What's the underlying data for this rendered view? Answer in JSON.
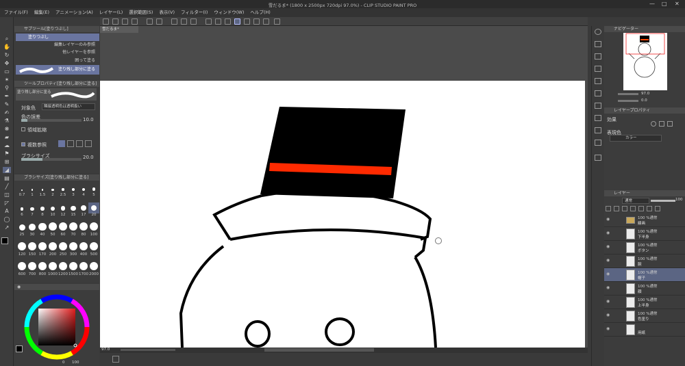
{
  "window": {
    "title": "雪だるま* (1800 x 2500px 720dpi 97.0%) - CLIP STUDIO PAINT PRO"
  },
  "menu": [
    "ファイル(F)",
    "編集(E)",
    "アニメーション(A)",
    "レイヤー(L)",
    "選択範囲(S)",
    "表示(V)",
    "フィルター(I)",
    "ウィンドウ(W)",
    "ヘルプ(H)"
  ],
  "document_tab": "雪だるま*",
  "subtool": {
    "header": "サブツール[塗りつぶし]",
    "items": [
      "塗りつぶし",
      "編集レイヤーのみ参照",
      "他レイヤーを参照",
      "囲って塗る",
      "塗り残し部分に塗る"
    ],
    "selected": "塗り残し部分に塗る"
  },
  "tool_property": {
    "header": "ツールプロパティ[塗り残し部分に塗る]",
    "brush_name": "塗り残し部分に塗る",
    "target_color_label": "対象色",
    "target_color_value": "隣接透明色は透明扱い",
    "color_margin_label": "色の誤差",
    "color_margin_value": "10.0",
    "area_scaling_label": "領域拡縮",
    "multi_ref_label": "複数参照",
    "brush_size_label": "ブラシサイズ",
    "brush_size_value": "20.0"
  },
  "brush_size_panel": {
    "header": "ブラシサイズ[塗り残し部分に塗る]",
    "sizes": [
      "0.7",
      "1",
      "1.5",
      "2",
      "2.5",
      "3",
      "4",
      "5",
      "6",
      "7",
      "8",
      "10",
      "12",
      "15",
      "17",
      "20",
      "25",
      "30",
      "40",
      "50",
      "60",
      "70",
      "80",
      "100",
      "120",
      "150",
      "170",
      "200",
      "250",
      "300",
      "400",
      "500",
      "600",
      "700",
      "800",
      "1000",
      "1200",
      "1500",
      "1700",
      "2000"
    ],
    "selected": "20"
  },
  "color_panel": {
    "value_label": "0",
    "size_label": "100"
  },
  "statusbar": {
    "zoom": "97.0"
  },
  "navigator": {
    "header": "ナビゲーター",
    "zoom": "97.0",
    "rotation": "0.0"
  },
  "layer_property": {
    "header": "レイヤープロパティ",
    "effect_label": "効果",
    "expression_color_label": "表現色",
    "expression_color_value": "カラー"
  },
  "layer_panel": {
    "header": "レイヤー",
    "blend_mode": "通常",
    "opacity": "100",
    "layers": [
      {
        "opacity_mode": "100 %通常",
        "name": "線画",
        "type": "folder"
      },
      {
        "opacity_mode": "100 %通常",
        "name": "下半身",
        "type": "layer"
      },
      {
        "opacity_mode": "100 %通常",
        "name": "ボタン",
        "type": "layer"
      },
      {
        "opacity_mode": "100 %通常",
        "name": "腕",
        "type": "layer"
      },
      {
        "opacity_mode": "100 %通常",
        "name": "帽子",
        "type": "layer",
        "selected": true
      },
      {
        "opacity_mode": "100 %通常",
        "name": "顔",
        "type": "layer"
      },
      {
        "opacity_mode": "100 %通常",
        "name": "上半身",
        "type": "layer"
      },
      {
        "opacity_mode": "100 %通常",
        "name": "色塗り",
        "type": "layer"
      },
      {
        "opacity_mode": "",
        "name": "用紙",
        "type": "paper"
      }
    ]
  },
  "colors": {
    "hat": "#000000",
    "hat_band": "#ff2a00",
    "line": "#000000",
    "selection": "#5b6583",
    "panel_bg": "#3c3c3c"
  },
  "icons": [
    "zoom-icon",
    "hand-icon",
    "rotate-icon",
    "move-icon",
    "select-icon",
    "wand-icon",
    "eyedropper-icon",
    "pen-icon",
    "pencil-icon",
    "brush-icon",
    "airbrush-icon",
    "eraser-icon",
    "fill-icon",
    "gradient-icon",
    "text-icon",
    "ruler-icon",
    "balloon-icon",
    "correct-line-icon"
  ]
}
